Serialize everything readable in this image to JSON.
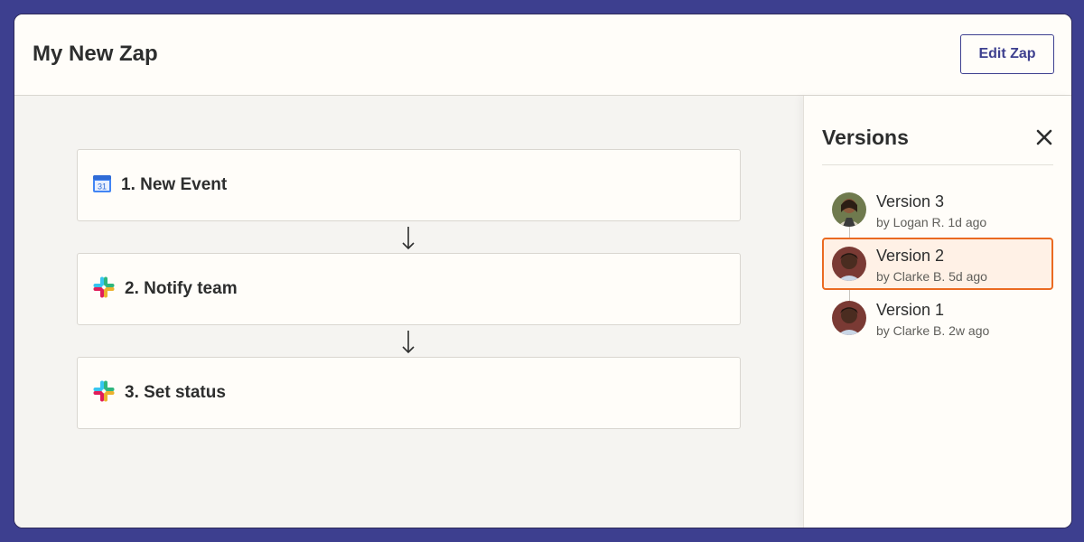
{
  "header": {
    "title": "My New Zap",
    "edit_button": "Edit Zap"
  },
  "steps": [
    {
      "label": "1. New Event",
      "icon": "google-calendar-icon"
    },
    {
      "label": "2. Notify team",
      "icon": "slack-icon"
    },
    {
      "label": "3. Set status",
      "icon": "slack-icon"
    }
  ],
  "calendar_icon_text": "31",
  "versions_panel": {
    "title": "Versions",
    "items": [
      {
        "name": "Version 3",
        "meta": "by Logan R. 1d ago",
        "selected": false
      },
      {
        "name": "Version 2",
        "meta": "by Clarke B. 5d ago",
        "selected": true
      },
      {
        "name": "Version 1",
        "meta": "by Clarke B. 2w ago",
        "selected": false
      }
    ]
  },
  "colors": {
    "background": "#3d3f8f",
    "accent": "#3d3f8f",
    "selected_border": "#ea6a21",
    "selected_fill": "#fff1e6"
  }
}
